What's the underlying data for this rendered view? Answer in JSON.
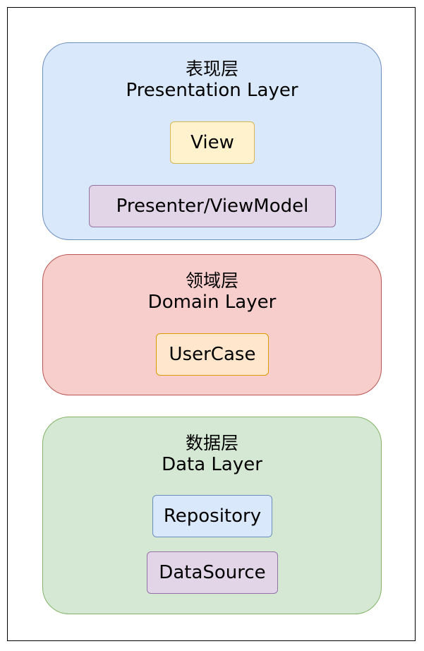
{
  "colors": {
    "presentation_fill": "#dae8fc",
    "presentation_stroke": "#6c8ebf",
    "domain_fill": "#f8cecc",
    "domain_stroke": "#b85450",
    "data_fill": "#d5e8d4",
    "data_stroke": "#82b366",
    "yellow_fill": "#fff2cc",
    "yellow_stroke": "#d6b656",
    "purple_fill": "#e1d5e7",
    "purple_stroke": "#9673a6",
    "orange_fill": "#ffe6cc",
    "orange_stroke": "#d79b00",
    "blue_fill": "#dae8fc",
    "blue_stroke": "#6c8ebf"
  },
  "layers": {
    "presentation": {
      "title_zh": "表现层",
      "title_en": "Presentation Layer",
      "components": [
        "View",
        "Presenter/ViewModel"
      ]
    },
    "domain": {
      "title_zh": "领域层",
      "title_en": "Domain Layer",
      "components": [
        "UserCase"
      ]
    },
    "data": {
      "title_zh": "数据层",
      "title_en": "Data Layer",
      "components": [
        "Repository",
        "DataSource"
      ]
    }
  }
}
